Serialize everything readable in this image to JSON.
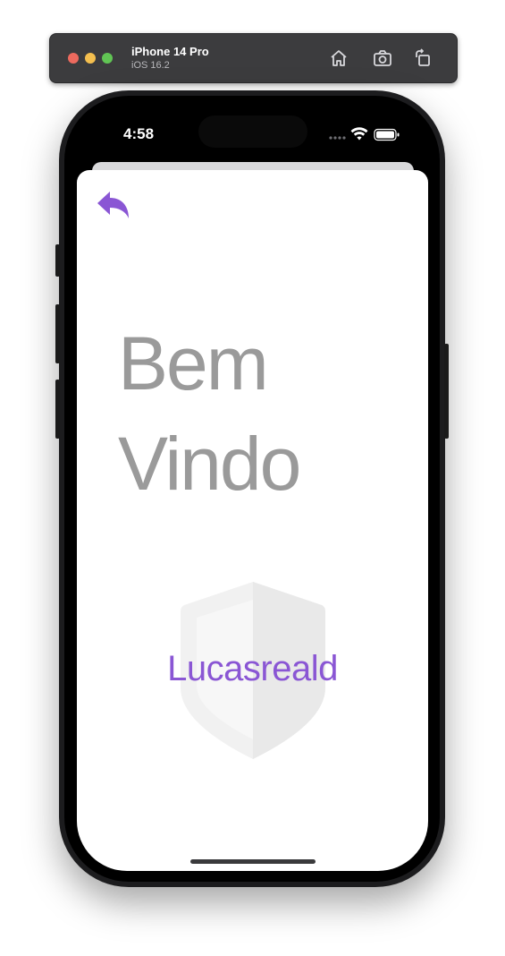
{
  "simulator": {
    "device_name": "iPhone 14 Pro",
    "os_version": "iOS 16.2",
    "buttons": [
      "home-icon",
      "screenshot-icon",
      "rotate-icon"
    ]
  },
  "status_bar": {
    "time": "4:58",
    "icons": [
      "cellular-dots-icon",
      "wifi-icon",
      "battery-icon"
    ]
  },
  "screen": {
    "back_icon": "reply-arrow-icon",
    "welcome_line1": "Bem",
    "welcome_line2": "Vindo",
    "username": "Lucasreald",
    "background_icon": "shield-icon"
  },
  "colors": {
    "accent": "#8a56d4",
    "welcome_text": "#9a9a9a",
    "shield": "#f0f0f0"
  }
}
